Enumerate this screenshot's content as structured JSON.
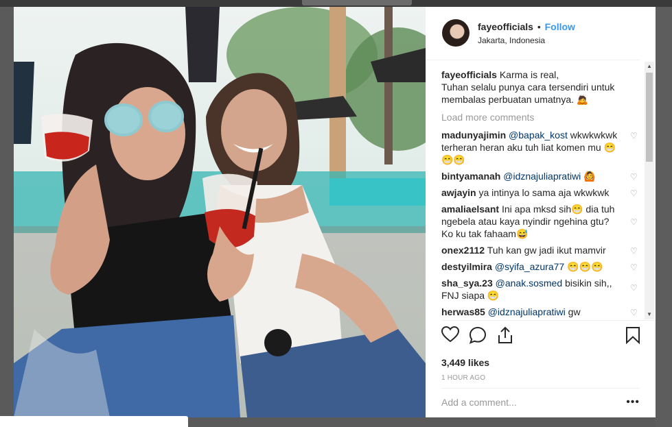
{
  "post": {
    "username": "fayeofficials",
    "separator": "•",
    "follow_label": "Follow",
    "location": "Jakarta, Indonesia"
  },
  "caption": {
    "username": "fayeofficials",
    "lines": [
      "Karma is real,",
      "Tuhan selalu punya cara tersendiri untuk",
      "membalas perbuatan umatnya. 🙇"
    ]
  },
  "load_more_label": "Load more comments",
  "comments": [
    {
      "user": "madunyajimin",
      "mention": "@bapak_kost",
      "text": " wkwkwkwk terheran heran aku tuh liat komen mu 😁😁😁"
    },
    {
      "user": "bintyamanah",
      "mention": "@idznajuliapratiwi",
      "text": " 🙆"
    },
    {
      "user": "awjayin",
      "mention": "",
      "text": "ya intinya lo sama aja wkwkwk"
    },
    {
      "user": "amaliaelsant",
      "mention": "",
      "text": "Ini apa mksd sih😁 dia tuh ngebela atau kaya nyindir ngehina gtu? Ko ku tak fahaam😅"
    },
    {
      "user": "onex2112",
      "mention": "",
      "text": "Tuh kan gw jadi ikut mamvir"
    },
    {
      "user": "destyilmira",
      "mention": "@syifa_azura77",
      "text": " 😁😁😁"
    },
    {
      "user": "sha_sya.23",
      "mention": "@anak.sosmed",
      "text": " bisikin sih,, FNJ siapa 😁"
    },
    {
      "user": "herwas85",
      "mention": "@idznajuliapratiwi",
      "text": " gw"
    }
  ],
  "likes": "3,449 likes",
  "timestamp": "1 HOUR AGO",
  "add_comment_placeholder": "Add a comment...",
  "more_label": "•••",
  "icons": {
    "like": "heart-icon",
    "comment": "comment-bubble-icon",
    "share": "share-icon",
    "save": "bookmark-icon",
    "comment_like": "small-heart-icon"
  },
  "colors": {
    "follow": "#3897f0",
    "mention": "#003569",
    "muted": "#999999",
    "text": "#262626"
  }
}
